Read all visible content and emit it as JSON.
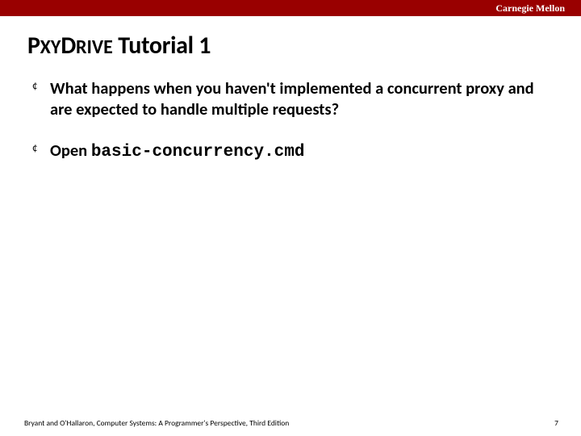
{
  "header": {
    "brand": "Carnegie Mellon"
  },
  "title": {
    "p": "P",
    "xy": "XY",
    "d": "D",
    "rive": "RIVE",
    "rest": " Tutorial 1"
  },
  "bullets": [
    {
      "text": "What happens when you haven't implemented a concurrent proxy and are expected to handle multiple requests?"
    },
    {
      "prefix": "Open ",
      "mono": "basic-concurrency.cmd"
    }
  ],
  "footer": {
    "credit": "Bryant and O'Hallaron, Computer Systems: A Programmer's Perspective, Third Edition",
    "page": "7"
  }
}
